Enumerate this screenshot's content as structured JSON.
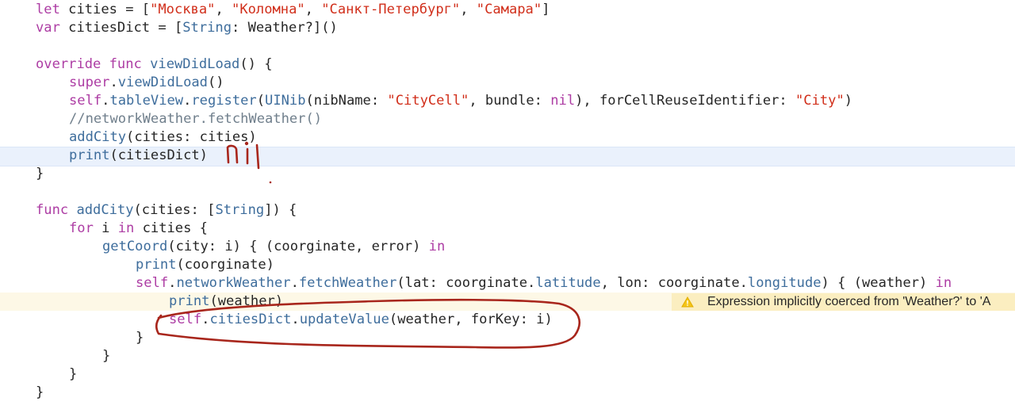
{
  "code_lines": [
    {
      "indent": 0,
      "tokens": [
        {
          "t": "let",
          "c": "kw"
        },
        {
          "t": " cities = [",
          "c": "pl"
        },
        {
          "t": "\"Москва\"",
          "c": "str"
        },
        {
          "t": ", ",
          "c": "pl"
        },
        {
          "t": "\"Коломна\"",
          "c": "str"
        },
        {
          "t": ", ",
          "c": "pl"
        },
        {
          "t": "\"Санкт-Петербург\"",
          "c": "str"
        },
        {
          "t": ", ",
          "c": "pl"
        },
        {
          "t": "\"Самара\"",
          "c": "str"
        },
        {
          "t": "]",
          "c": "pl"
        }
      ]
    },
    {
      "indent": 0,
      "tokens": [
        {
          "t": "var",
          "c": "kw"
        },
        {
          "t": " citiesDict = [",
          "c": "pl"
        },
        {
          "t": "String",
          "c": "ty"
        },
        {
          "t": ": Weather?]()",
          "c": "pl"
        }
      ]
    },
    {
      "indent": 0,
      "tokens": []
    },
    {
      "indent": 0,
      "tokens": [
        {
          "t": "override",
          "c": "kw"
        },
        {
          "t": " ",
          "c": "pl"
        },
        {
          "t": "func",
          "c": "kw"
        },
        {
          "t": " ",
          "c": "pl"
        },
        {
          "t": "viewDidLoad",
          "c": "fn"
        },
        {
          "t": "() {",
          "c": "pl"
        }
      ]
    },
    {
      "indent": 1,
      "tokens": [
        {
          "t": "super",
          "c": "kw"
        },
        {
          "t": ".",
          "c": "pl"
        },
        {
          "t": "viewDidLoad",
          "c": "pr"
        },
        {
          "t": "()",
          "c": "pl"
        }
      ]
    },
    {
      "indent": 1,
      "tokens": [
        {
          "t": "self",
          "c": "kw"
        },
        {
          "t": ".",
          "c": "pl"
        },
        {
          "t": "tableView",
          "c": "pr"
        },
        {
          "t": ".",
          "c": "pl"
        },
        {
          "t": "register",
          "c": "pr"
        },
        {
          "t": "(",
          "c": "pl"
        },
        {
          "t": "UINib",
          "c": "ty"
        },
        {
          "t": "(nibName: ",
          "c": "pl"
        },
        {
          "t": "\"CityCell\"",
          "c": "str"
        },
        {
          "t": ", bundle: ",
          "c": "pl"
        },
        {
          "t": "nil",
          "c": "kw"
        },
        {
          "t": "), forCellReuseIdentifier: ",
          "c": "pl"
        },
        {
          "t": "\"City\"",
          "c": "str"
        },
        {
          "t": ")",
          "c": "pl"
        }
      ]
    },
    {
      "indent": 1,
      "tokens": [
        {
          "t": "//networkWeather.fetchWeather()",
          "c": "cm"
        }
      ]
    },
    {
      "indent": 1,
      "tokens": [
        {
          "t": "addCity",
          "c": "pr"
        },
        {
          "t": "(cities: cities)",
          "c": "pl"
        }
      ]
    },
    {
      "indent": 1,
      "tokens": [
        {
          "t": "print",
          "c": "pr"
        },
        {
          "t": "(citiesDict)",
          "c": "pl"
        }
      ]
    },
    {
      "indent": 0,
      "tokens": [
        {
          "t": "}",
          "c": "pl"
        }
      ]
    },
    {
      "indent": 0,
      "tokens": []
    },
    {
      "indent": 0,
      "tokens": [
        {
          "t": "func",
          "c": "kw"
        },
        {
          "t": " ",
          "c": "pl"
        },
        {
          "t": "addCity",
          "c": "fn"
        },
        {
          "t": "(cities: [",
          "c": "pl"
        },
        {
          "t": "String",
          "c": "ty"
        },
        {
          "t": "]) {",
          "c": "pl"
        }
      ]
    },
    {
      "indent": 1,
      "tokens": [
        {
          "t": "for",
          "c": "kw"
        },
        {
          "t": " i ",
          "c": "pl"
        },
        {
          "t": "in",
          "c": "kw"
        },
        {
          "t": " cities {",
          "c": "pl"
        }
      ]
    },
    {
      "indent": 2,
      "tokens": [
        {
          "t": "getCoord",
          "c": "pr"
        },
        {
          "t": "(city: i) { (coorginate, error) ",
          "c": "pl"
        },
        {
          "t": "in",
          "c": "kw"
        }
      ]
    },
    {
      "indent": 3,
      "tokens": [
        {
          "t": "print",
          "c": "pr"
        },
        {
          "t": "(coorginate)",
          "c": "pl"
        }
      ]
    },
    {
      "indent": 3,
      "tokens": [
        {
          "t": "self",
          "c": "kw"
        },
        {
          "t": ".",
          "c": "pl"
        },
        {
          "t": "networkWeather",
          "c": "pr"
        },
        {
          "t": ".",
          "c": "pl"
        },
        {
          "t": "fetchWeather",
          "c": "pr"
        },
        {
          "t": "(lat: coorginate.",
          "c": "pl"
        },
        {
          "t": "latitude",
          "c": "pr"
        },
        {
          "t": ", lon: coorginate.",
          "c": "pl"
        },
        {
          "t": "longitude",
          "c": "pr"
        },
        {
          "t": ") { (weather) ",
          "c": "pl"
        },
        {
          "t": "in",
          "c": "kw"
        }
      ]
    },
    {
      "indent": 4,
      "tokens": [
        {
          "t": "print",
          "c": "pr"
        },
        {
          "t": "(weather)",
          "c": "pl"
        }
      ]
    },
    {
      "indent": 4,
      "tokens": [
        {
          "t": "self",
          "c": "kw"
        },
        {
          "t": ".",
          "c": "pl"
        },
        {
          "t": "citiesDict",
          "c": "pr"
        },
        {
          "t": ".",
          "c": "pl"
        },
        {
          "t": "updateValue",
          "c": "pr"
        },
        {
          "t": "(weather, forKey: i)",
          "c": "pl"
        }
      ]
    },
    {
      "indent": 3,
      "tokens": [
        {
          "t": "}",
          "c": "pl"
        }
      ]
    },
    {
      "indent": 2,
      "tokens": [
        {
          "t": "}",
          "c": "pl"
        }
      ]
    },
    {
      "indent": 1,
      "tokens": [
        {
          "t": "}",
          "c": "pl"
        }
      ]
    },
    {
      "indent": 0,
      "tokens": [
        {
          "t": "}",
          "c": "pl"
        }
      ]
    }
  ],
  "highlighted_line": 8,
  "warning": {
    "line": 16,
    "icon": "warning-triangle-icon",
    "text": "Expression implicitly coerced from 'Weather?' to 'A"
  },
  "annotations": {
    "handwritten_note": "nil",
    "color": "#a8261c"
  },
  "colors": {
    "keyword": "#ad3da4",
    "string": "#d12f1b",
    "comment": "#707f8c",
    "identifier": "#3e6d9c",
    "plain": "#262626",
    "current_line": "#eaf1fc",
    "warning_banner": "#fbeec0"
  }
}
